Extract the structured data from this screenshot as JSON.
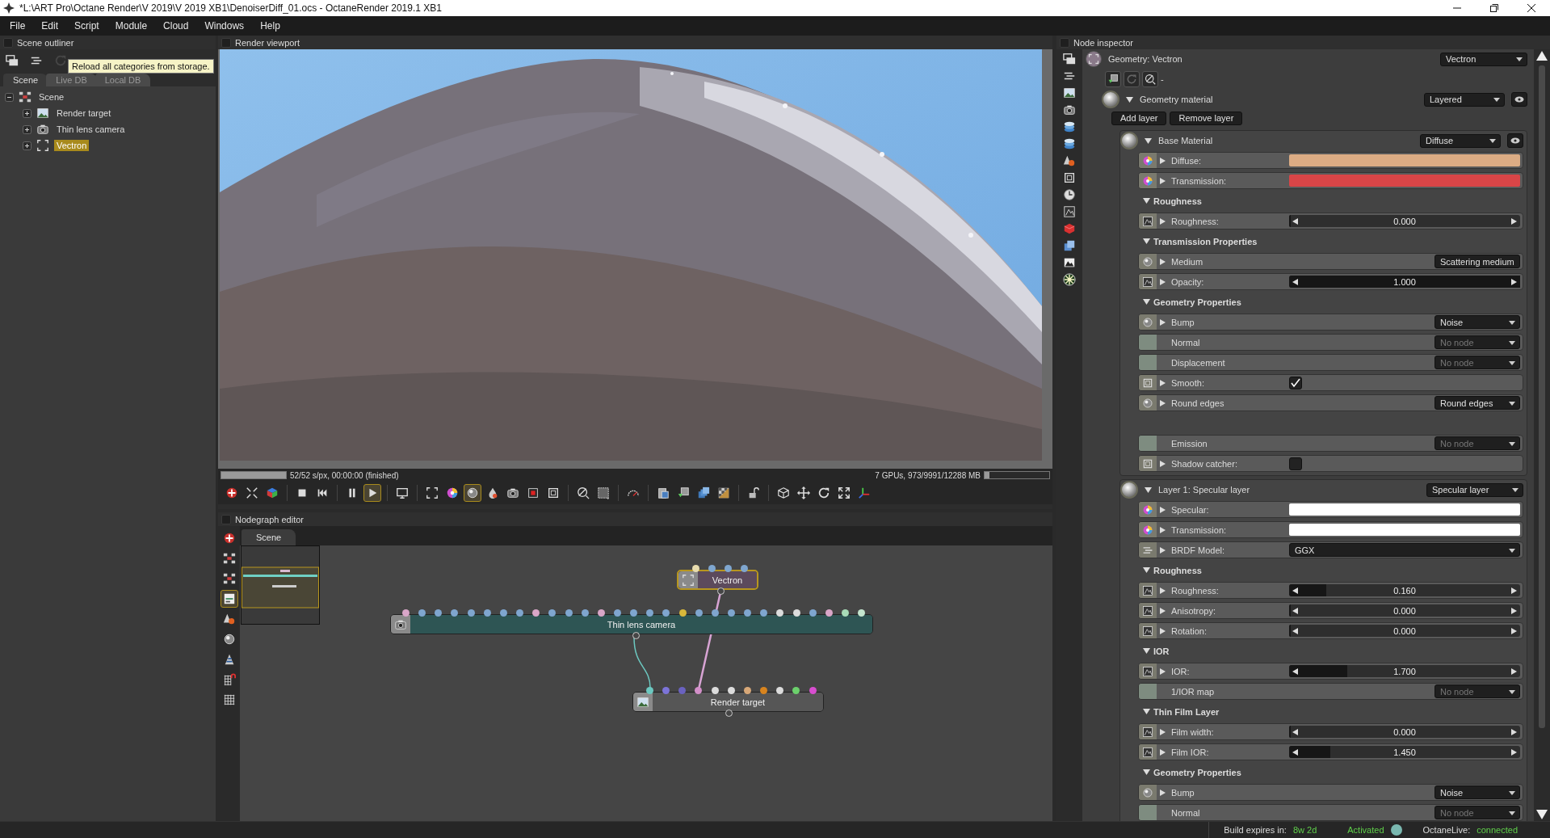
{
  "window": {
    "title": "*L:\\ART Pro\\Octane Render\\V 2019\\V 2019 XB1\\DenoiserDiff_01.ocs - OctaneRender 2019.1 XB1"
  },
  "menu": [
    "File",
    "Edit",
    "Script",
    "Module",
    "Cloud",
    "Windows",
    "Help"
  ],
  "scene_outliner": {
    "title": "Scene outliner",
    "tools": [
      {
        "disabled": false
      },
      {
        "disabled": false
      },
      {
        "disabled": true
      }
    ],
    "tooltip": "Reload all categories from storage.",
    "tabs": [
      {
        "label": "Scene",
        "selected": true
      },
      {
        "label": "Live DB",
        "selected": false
      },
      {
        "label": "Local DB",
        "selected": false
      }
    ],
    "tree": [
      {
        "label": "Scene",
        "kind": "scene",
        "expanded": true,
        "selected": false,
        "children": [
          {
            "label": "Render target",
            "kind": "render_target",
            "expanded": false,
            "selected": false
          },
          {
            "label": "Thin lens camera",
            "kind": "camera",
            "expanded": false,
            "selected": false
          },
          {
            "label": "Vectron",
            "kind": "geometry",
            "expanded": false,
            "selected": true
          }
        ]
      }
    ]
  },
  "render_viewport": {
    "title": "Render viewport",
    "progress": {
      "level": 1
    },
    "progress_text": "52/52 s/px, 00:00:00 (finished)",
    "gpu_text": "7 GPUs, 973/9991/12288 MB",
    "memory": {
      "level": 0.08
    },
    "toolbar": [
      {
        "selected": false
      },
      {
        "selected": false
      },
      {
        "selected": false
      },
      {
        "selected": false
      },
      {
        "selected": false
      },
      {
        "selected": false
      },
      {
        "selected": true
      },
      {
        "selected": false
      },
      {
        "selected": false
      },
      {
        "selected": false
      },
      {
        "selected": true
      },
      {
        "selected": false
      },
      {
        "selected": false
      },
      {
        "selected": false
      },
      {
        "selected": false
      },
      {
        "selected": false
      },
      {
        "selected": false
      },
      {
        "selected": false
      },
      {
        "selected": false
      },
      {
        "selected": false
      },
      {
        "selected": false
      },
      {
        "selected": false
      },
      {
        "selected": false
      },
      {
        "selected": false
      },
      {
        "selected": false
      },
      {
        "selected": false
      },
      {
        "selected": false
      },
      {
        "selected": false
      }
    ]
  },
  "nodegraph": {
    "title": "Nodegraph editor",
    "tools": [
      {
        "selected": false
      },
      {
        "selected": false
      },
      {
        "selected": false
      },
      {
        "selected": true
      },
      {
        "selected": false
      },
      {
        "selected": false
      },
      {
        "selected": false
      },
      {
        "selected": false
      },
      {
        "selected": false
      }
    ],
    "tabs": [
      {
        "label": "Scene",
        "selected": true
      }
    ],
    "nodes": [
      {
        "label": "Vectron",
        "kind": "geometry",
        "selected": true,
        "pins": [
          {
            "color": "#e8dcae"
          },
          {
            "color": "#7fa6cf"
          },
          {
            "color": "#7fa6cf"
          },
          {
            "color": "#7fa6cf"
          }
        ]
      },
      {
        "label": "Thin lens camera",
        "kind": "camera",
        "selected": false,
        "pins": [
          {
            "color": "#d9a6c8"
          },
          {
            "color": "#7fa6cf"
          },
          {
            "color": "#7fa6cf"
          },
          {
            "color": "#7fa6cf"
          },
          {
            "color": "#7fa6cf"
          },
          {
            "color": "#7fa6cf"
          },
          {
            "color": "#7fa6cf"
          },
          {
            "color": "#7fa6cf"
          },
          {
            "color": "#d9a6c8"
          },
          {
            "color": "#7fa6cf"
          },
          {
            "color": "#7fa6cf"
          },
          {
            "color": "#7fa6cf"
          },
          {
            "color": "#d9a6c8"
          },
          {
            "color": "#7fa6cf"
          },
          {
            "color": "#7fa6cf"
          },
          {
            "color": "#7fa6cf"
          },
          {
            "color": "#7fa6cf"
          },
          {
            "color": "#d8b83a"
          },
          {
            "color": "#7fa6cf"
          },
          {
            "color": "#7fa6cf"
          },
          {
            "color": "#7fa6cf"
          },
          {
            "color": "#7fa6cf"
          },
          {
            "color": "#7fa6cf"
          },
          {
            "color": "#dcdcdc"
          },
          {
            "color": "#dcdcdc"
          },
          {
            "color": "#7fa6cf"
          },
          {
            "color": "#d9a6c8"
          },
          {
            "color": "#a8dcb8"
          },
          {
            "color": "#c4e6cf"
          }
        ]
      },
      {
        "label": "Render target",
        "kind": "render_target",
        "selected": false,
        "pins": [
          {
            "color": "#6cc8c0"
          },
          {
            "color": "#7c74d8"
          },
          {
            "color": "#6a62c0"
          },
          {
            "color": "#d38fc9"
          },
          {
            "color": "#dcdcdc"
          },
          {
            "color": "#dcdcdc"
          },
          {
            "color": "#d8a878"
          },
          {
            "color": "#d8841e"
          },
          {
            "color": "#dcdcdc"
          },
          {
            "color": "#6cd06c"
          },
          {
            "color": "#d84ed0"
          }
        ]
      }
    ]
  },
  "inspector": {
    "title": "Node inspector",
    "node_title": "Geometry: Vectron",
    "node_choice": "Vectron",
    "toolbar_text": "-",
    "material": {
      "label": "Geometry material",
      "type": "Layered",
      "expanded": true,
      "buttons": [
        "Add layer",
        "Remove layer"
      ],
      "layers": [
        {
          "label": "Base Material",
          "type": "Diffuse",
          "expanded": true,
          "visibility_toggle": true,
          "items": [
            {
              "kind": "color",
              "label": "Diffuse:",
              "color": "#dcac84"
            },
            {
              "kind": "color",
              "label": "Transmission:",
              "color": "#d94547"
            },
            {
              "kind": "header",
              "label": "Roughness",
              "expanded": true
            },
            {
              "kind": "slider",
              "label": "Roughness:",
              "value": "0.000",
              "level": 0
            },
            {
              "kind": "header",
              "label": "Transmission Properties",
              "expanded": true
            },
            {
              "kind": "link",
              "label": "Medium",
              "value": "Scattering medium",
              "empty": false
            },
            {
              "kind": "slider",
              "label": "Opacity:",
              "value": "1.000",
              "level": 1
            },
            {
              "kind": "header",
              "label": "Geometry Properties",
              "expanded": true
            },
            {
              "kind": "link",
              "label": "Bump",
              "value": "Noise",
              "empty": false
            },
            {
              "kind": "link",
              "label": "Normal",
              "value": "No node",
              "empty": true
            },
            {
              "kind": "link",
              "label": "Displacement",
              "value": "No node",
              "empty": true
            },
            {
              "kind": "checkbox",
              "label": "Smooth:",
              "checked": true
            },
            {
              "kind": "link",
              "label": "Round edges",
              "value": "Round edges",
              "empty": false
            },
            {
              "kind": "spacer"
            },
            {
              "kind": "link",
              "label": "Emission",
              "value": "No node",
              "empty": true
            },
            {
              "kind": "checkbox",
              "label": "Shadow catcher:",
              "checked": false
            }
          ]
        },
        {
          "label": "Layer 1: Specular layer",
          "type": "Specular layer",
          "expanded": true,
          "visibility_toggle": false,
          "items": [
            {
              "kind": "color",
              "label": "Specular:",
              "color": "#ffffff"
            },
            {
              "kind": "color",
              "label": "Transmission:",
              "color": "#ffffff"
            },
            {
              "kind": "enum",
              "label": "BRDF Model:",
              "value": "GGX"
            },
            {
              "kind": "header",
              "label": "Roughness",
              "expanded": true
            },
            {
              "kind": "slider",
              "label": "Roughness:",
              "value": "0.160",
              "level": 0.16
            },
            {
              "kind": "slider",
              "label": "Anisotropy:",
              "value": "0.000",
              "level": 0
            },
            {
              "kind": "slider",
              "label": "Rotation:",
              "value": "0.000",
              "level": 0
            },
            {
              "kind": "header",
              "label": "IOR",
              "expanded": true
            },
            {
              "kind": "slider",
              "label": "IOR:",
              "value": "1.700",
              "level": 0.25
            },
            {
              "kind": "link",
              "label": "1/IOR map",
              "value": "No node",
              "empty": true
            },
            {
              "kind": "header",
              "label": "Thin Film Layer",
              "expanded": true
            },
            {
              "kind": "slider",
              "label": "Film width:",
              "value": "0.000",
              "level": 0
            },
            {
              "kind": "slider",
              "label": "Film IOR:",
              "value": "1.450",
              "level": 0.18
            },
            {
              "kind": "header",
              "label": "Geometry Properties",
              "expanded": true
            },
            {
              "kind": "link",
              "label": "Bump",
              "value": "Noise",
              "empty": false
            },
            {
              "kind": "link",
              "label": "Normal",
              "value": "No node",
              "empty": true
            }
          ]
        }
      ]
    }
  },
  "status_bar": {
    "build_label": "Build expires in:",
    "build_value": "8w 2d",
    "activation": "Activated",
    "live_label": "OctaneLive:",
    "live_value": "connected"
  }
}
